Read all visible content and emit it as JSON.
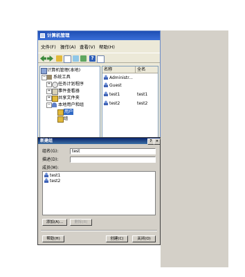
{
  "main_window": {
    "title": "计算机管理",
    "menu": [
      "文件(F)",
      "操作(A)",
      "查看(V)",
      "帮助(H)"
    ],
    "tree": [
      {
        "label": "计算机管理(本地)",
        "indent": 0,
        "icon": "computer-icon",
        "expander": ""
      },
      {
        "label": "系统工具",
        "indent": 1,
        "icon": "tools-icon",
        "expander": "−"
      },
      {
        "label": "任务计划程序",
        "indent": 2,
        "icon": "clock-icon",
        "expander": "+"
      },
      {
        "label": "事件查看器",
        "indent": 2,
        "icon": "event-viewer-icon",
        "expander": "+"
      },
      {
        "label": "共享文件夹",
        "indent": 2,
        "icon": "shared-folder-icon",
        "expander": "+"
      },
      {
        "label": "本地用户和组",
        "indent": 2,
        "icon": "users-icon",
        "expander": "−"
      },
      {
        "label": "用户",
        "indent": 3,
        "icon": "folder-icon",
        "expander": "",
        "selected": true
      },
      {
        "label": "组",
        "indent": 3,
        "icon": "folder-icon",
        "expander": ""
      }
    ],
    "list_headers": [
      "名称",
      "全名"
    ],
    "list_rows": [
      {
        "name": "Administr...",
        "full_name": ""
      },
      {
        "name": "Guest",
        "full_name": ""
      },
      {
        "name": "test1",
        "full_name": "test1"
      },
      {
        "name": "test2",
        "full_name": "test2"
      }
    ]
  },
  "dialog": {
    "title": "新建组",
    "controls": [
      "?",
      "×"
    ],
    "group_name_label": "组名(G):",
    "group_name_value": "test",
    "description_label": "描述(D):",
    "description_value": "",
    "members_label": "成员(M):",
    "members": [
      "test1",
      "test2"
    ],
    "add_button": "添加(A)...",
    "remove_button": "删除(R)",
    "help_button": "帮助(H)",
    "create_button": "创建(C)",
    "close_button": "关闭(O)"
  },
  "colors": {
    "titlebar": "#2a5cc6",
    "dialog_titlebar": "#0a246a",
    "window_bg": "#ece9d8",
    "dialog_bg": "#d4d0c8",
    "selection": "#316ac5"
  }
}
